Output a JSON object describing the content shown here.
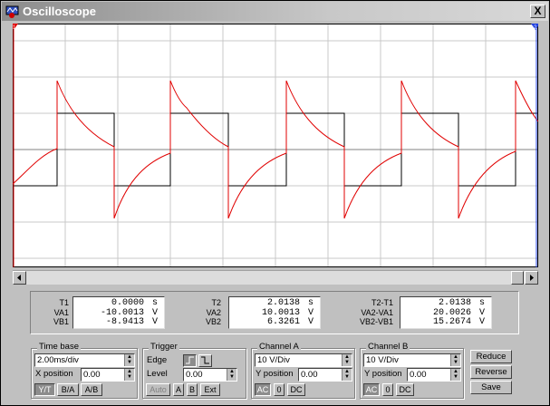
{
  "window": {
    "title": "Oscilloscope",
    "close_glyph": "X"
  },
  "markers": {
    "t1_label": "1",
    "t2_label": "2"
  },
  "readout": {
    "t1": {
      "labels": [
        "T1",
        "VA1",
        "VB1"
      ],
      "values": [
        "0.0000",
        "-10.0013",
        "-8.9413"
      ],
      "units": [
        "s",
        "V",
        "V"
      ]
    },
    "t2": {
      "labels": [
        "T2",
        "VA2",
        "VB2"
      ],
      "values": [
        "2.0138",
        "10.0013",
        "6.3261"
      ],
      "units": [
        "s",
        "V",
        "V"
      ]
    },
    "diff": {
      "labels": [
        "T2-T1",
        "VA2-VA1",
        "VB2-VB1"
      ],
      "values": [
        "2.0138",
        "20.0026",
        "15.2674"
      ],
      "units": [
        "s",
        "V",
        "V"
      ]
    }
  },
  "timebase": {
    "title": "Time base",
    "scale": "2.00ms/div",
    "xpos_label": "X position",
    "xpos": "0.00",
    "modes": [
      "Y/T",
      "B/A",
      "A/B"
    ]
  },
  "trigger": {
    "title": "Trigger",
    "edge_label": "Edge",
    "level_label": "Level",
    "level": "0.00",
    "buttons": [
      "Auto",
      "A",
      "B",
      "Ext"
    ]
  },
  "channel_a": {
    "title": "Channel A",
    "scale": "10 V/Div",
    "ypos_label": "Y position",
    "ypos": "0.00",
    "coupling": [
      "AC",
      "0",
      "DC"
    ]
  },
  "channel_b": {
    "title": "Channel B",
    "scale": "10 V/Div",
    "ypos_label": "Y position",
    "ypos": "0.00",
    "coupling": [
      "AC",
      "0",
      "DC"
    ]
  },
  "actions": {
    "reduce": "Reduce",
    "reverse": "Reverse",
    "save": "Save"
  },
  "colors": {
    "trace_b": "#e00000",
    "trace_a": "#000000",
    "grid": "#c8c8c8",
    "marker_t1": "#e00000",
    "marker_t2": "#2040e0"
  }
}
